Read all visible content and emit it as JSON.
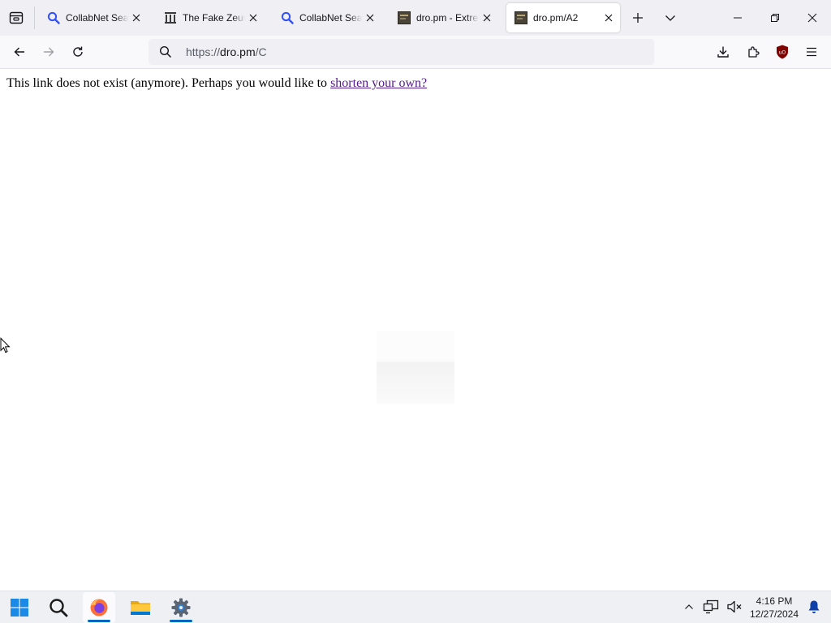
{
  "tabs": [
    {
      "title": "CollabNet SearX",
      "icon": "search-icon"
    },
    {
      "title": "The Fake Zeus Website",
      "icon": "museum-icon"
    },
    {
      "title": "CollabNet SearX",
      "icon": "search-icon"
    },
    {
      "title": "dro.pm - Extremely short links",
      "icon": "dropm-favicon"
    },
    {
      "title": "dro.pm/A2",
      "icon": "dropm-favicon",
      "active": true
    }
  ],
  "address_bar": {
    "scheme": "https://",
    "host": "dro.pm",
    "path": "/C"
  },
  "page": {
    "message": "This link does not exist (anymore). Perhaps you would like to ",
    "link_text": "shorten your own?"
  },
  "taskbar": {
    "apps": [
      "start-icon",
      "search-icon",
      "firefox-icon",
      "file-explorer-icon",
      "settings-icon"
    ],
    "time": "4:16 PM",
    "date": "12/27/2024"
  },
  "colors": {
    "accent": "#0067c0",
    "visited_link": "#551a8b",
    "ublock_shield": "#800000"
  }
}
